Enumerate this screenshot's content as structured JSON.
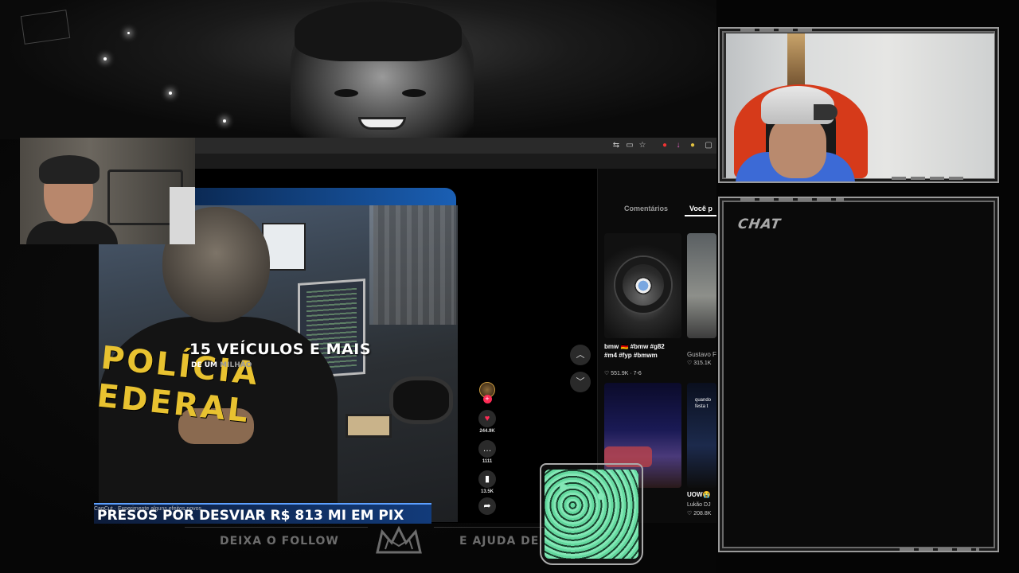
{
  "browser": {
    "toolbar_icons": [
      "translate-icon",
      "cast-icon",
      "bookmark-star-icon",
      "extension-red-icon",
      "download-icon",
      "profile-icon",
      "extensions-icon"
    ]
  },
  "video": {
    "overlay_title": "15 VEÍCULOS E MAIS",
    "overlay_sub_prefix": "DE UM ",
    "overlay_sub_faded": "MILHÃO",
    "jacket_text_line1": "POLÍCIA",
    "jacket_text_line2": "EDERAL",
    "ticker": "PRESOS POR DESVIAR R$ 813 MI EM PIX",
    "capcut_notice": "CapCut · Experimente alguns efeitos novos"
  },
  "actions": {
    "likes": "244.9K",
    "comments": "1111",
    "saves": "13.5K"
  },
  "side_panel": {
    "tabs": [
      "Comentários",
      "Você p"
    ],
    "cards": [
      {
        "caption_line1": "bmw 🇩🇪 #bmw #g82",
        "caption_line2": "#m4 #fyp #bmwm",
        "meta": "♡ 551.9K · 7-6"
      },
      {
        "caption_line1": "Gustavo F",
        "meta": "♡ 315.1K"
      },
      {
        "caption_line1": "UOW😭",
        "caption_line2": "Lukão DJ",
        "meta": "♡ 208.8K",
        "overlay": "quando festa t"
      }
    ]
  },
  "chat": {
    "title": "CHAT"
  },
  "bottom": {
    "left_text": "DEIXA O FOLLOW",
    "right_text": "E AJUDA DE"
  },
  "colors": {
    "accent_red": "#fe2c55",
    "ticker_blue": "#123b7a",
    "police_yellow": "#e8c230",
    "frame_gray": "#9a9a9a"
  }
}
